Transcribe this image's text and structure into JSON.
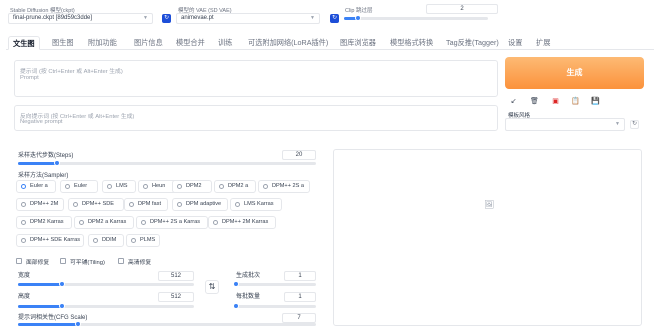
{
  "header": {
    "ckpt_label": "Stable Diffusion 模型(ckpt)",
    "ckpt_value": "final-prune.ckpt [89d59c3dde]",
    "vae_label": "模型的 VAE (SD VAE)",
    "vae_value": "animevae.pt",
    "clip_label": "Clip 跳过层",
    "clip_value": "2",
    "clip_fraction": 0.1
  },
  "tabs": [
    "文生图",
    "图生图",
    "附加功能",
    "图片信息",
    "模型合并",
    "训练",
    "可选附加网络(LoRA插件)",
    "图库浏览器",
    "模型格式转换",
    "Tag反推(Tagger)",
    "设置",
    "扩展"
  ],
  "prompt": {
    "placeholder_cn": "提示词 (按 Ctrl+Enter 或 Alt+Enter 生成)",
    "placeholder_en": "Prompt"
  },
  "negative": {
    "placeholder_cn": "反向提示词 (按 Ctrl+Enter 或 Alt+Enter 生成)",
    "placeholder_en": "Negative prompt"
  },
  "generate_label": "生成",
  "tools": {
    "icons": [
      "arrow-icon",
      "trash-icon",
      "red-card-icon",
      "clipboard-icon",
      "save-icon"
    ],
    "glyphs": [
      "↙",
      "🗑",
      "▣",
      "📋",
      "💾"
    ],
    "style_label": "模板风格"
  },
  "steps": {
    "label": "采样迭代步数(Steps)",
    "value": "20",
    "fraction": 0.13
  },
  "sampler": {
    "label": "采样方法(Sampler)",
    "options": [
      "Euler a",
      "Euler",
      "LMS",
      "Heun",
      "DPM2",
      "DPM2 a",
      "DPM++ 2S a",
      "DPM++ 2M",
      "DPM++ SDE",
      "DPM fast",
      "DPM adaptive",
      "LMS Karras",
      "DPM2 Karras",
      "DPM2 a Karras",
      "DPM++ 2S a Karras",
      "DPM++ 2M Karras",
      "DPM++ SDE Karras",
      "DDIM",
      "PLMS"
    ],
    "selected": "Euler a"
  },
  "checks": [
    "面部修复",
    "可平铺(Tiling)",
    "高清修复"
  ],
  "width": {
    "label": "宽度",
    "value": "512",
    "fraction": 0.25
  },
  "height": {
    "label": "高度",
    "value": "512",
    "fraction": 0.25
  },
  "swap_icon": "swap-icon",
  "swap_glyph": "⇅",
  "batch_count": {
    "label": "生成批次",
    "value": "1",
    "fraction": 0.0
  },
  "batch_size": {
    "label": "每批数量",
    "value": "1",
    "fraction": 0.0
  },
  "cfg": {
    "label": "提示词相关性(CFG Scale)",
    "value": "7",
    "fraction": 0.2
  },
  "output_icon": "image-placeholder-icon",
  "output_glyph": "🖼"
}
